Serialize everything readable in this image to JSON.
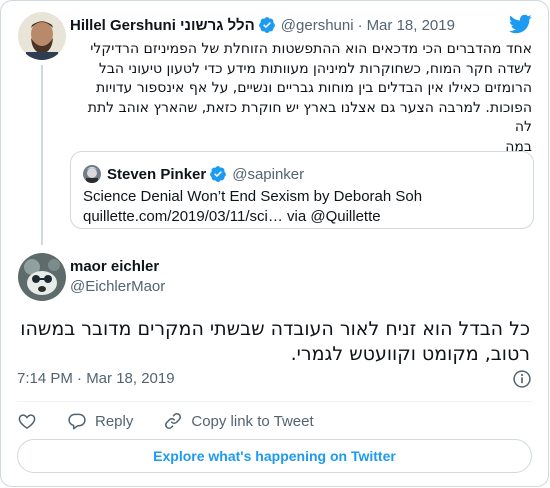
{
  "colors": {
    "accent": "#1d9bf0",
    "text": "#0f1419",
    "muted": "#536471",
    "border": "#cfd9de"
  },
  "parent_tweet": {
    "author_name": "Hillel Gershuni הלל גרשוני",
    "handle": "@gershuni",
    "separator": "·",
    "date": "Mar 18, 2019",
    "text_lines": [
      "אחד מהדברים הכי מדכאים הוא ההתפשטות הזוחלת של הפמיניזם הרדיקלי",
      "לשדה חקר המוח, כשחוקרות למיניהן מעוותות מידע כדי לטעון טיעוני הבל",
      "הרומזים כאילו אין הבדלים בין מוחות גבריים ונשיים, על אף אינספור עדויות",
      "הפוכות. למרבה הצער גם אצלנו בארץ יש חוקרת כזאת, שהארץ אוהב לתת לה",
      "במה"
    ],
    "quoted": {
      "author_name": "Steven Pinker",
      "handle": "@sapinker",
      "line1": "Science Denial Won’t End Sexism by Deborah Soh",
      "line2": "quillette.com/2019/03/11/sci… via @Quillette"
    }
  },
  "main_tweet": {
    "author_name": "maor eichler",
    "handle": "@EichlerMaor",
    "text_lines": [
      "כל הבדל הוא זניח לאור העובדה שבשתי המקרים מדובר במשהו",
      "רטוב, מקומט וקוועטש לגמרי."
    ],
    "timestamp": "7:14 PM · Mar 18, 2019"
  },
  "actions": {
    "like_icon": "heart-icon",
    "reply_label": "Reply",
    "copy_link_label": "Copy link to Tweet"
  },
  "explore_label": "Explore what's happening on Twitter"
}
